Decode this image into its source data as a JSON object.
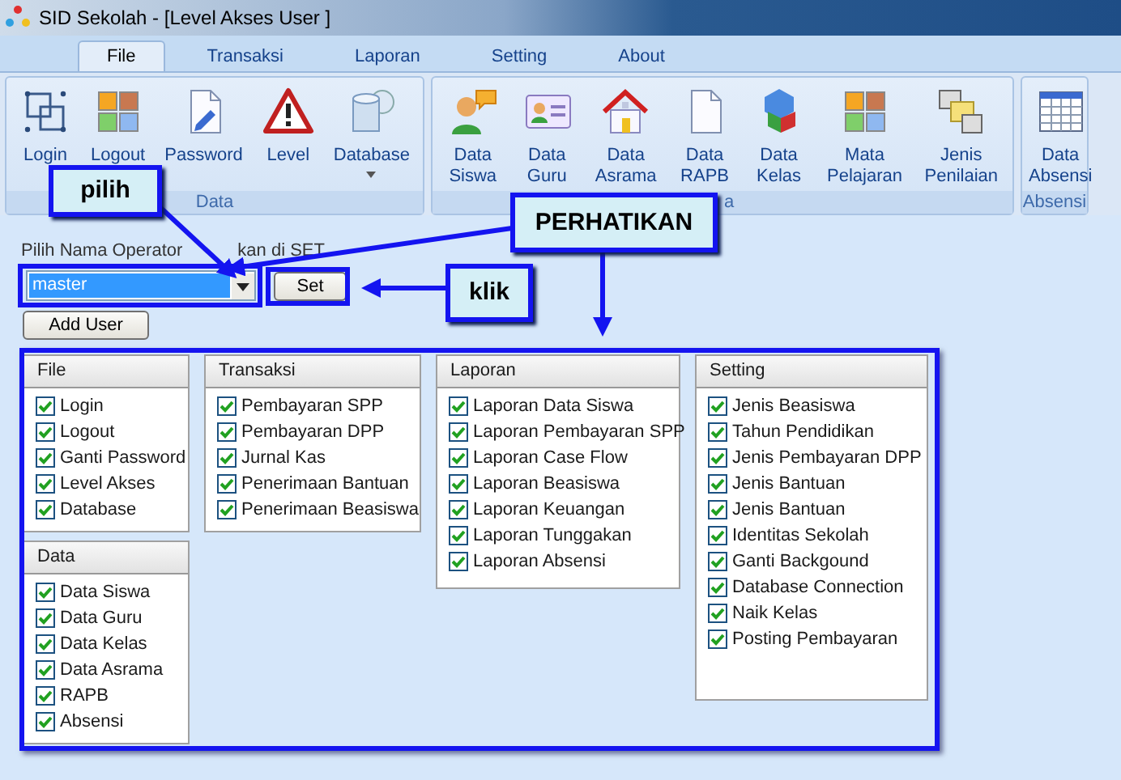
{
  "window": {
    "title": "SID Sekolah - [Level Akses User ]"
  },
  "tabs": [
    {
      "label": "File",
      "selected": true
    },
    {
      "label": "Transaksi",
      "selected": false
    },
    {
      "label": "Laporan",
      "selected": false
    },
    {
      "label": "Setting",
      "selected": false
    },
    {
      "label": "About",
      "selected": false
    }
  ],
  "ribbon": {
    "groups": [
      {
        "label": "Data",
        "buttons": [
          {
            "lines": [
              "Login"
            ]
          },
          {
            "lines": [
              "Logout"
            ]
          },
          {
            "lines": [
              "Password"
            ]
          },
          {
            "lines": [
              "Level"
            ]
          },
          {
            "lines": [
              "Database"
            ],
            "dropdown": true
          }
        ]
      },
      {
        "label": "a",
        "buttons": [
          {
            "lines": [
              "Data",
              "Siswa"
            ]
          },
          {
            "lines": [
              "Data",
              "Guru"
            ]
          },
          {
            "lines": [
              "Data",
              "Asrama"
            ]
          },
          {
            "lines": [
              "Data",
              "RAPB"
            ]
          },
          {
            "lines": [
              "Data",
              "Kelas"
            ]
          },
          {
            "lines": [
              "Mata",
              "Pelajaran"
            ]
          },
          {
            "lines": [
              "Jenis",
              "Penilaian"
            ]
          }
        ]
      },
      {
        "label": "Absensi",
        "buttons": [
          {
            "lines": [
              "Data",
              "Absensi"
            ]
          }
        ]
      }
    ]
  },
  "form": {
    "prompt": [
      "Pilih Nama Operator",
      "kan di SET"
    ],
    "operator": {
      "value": "master"
    },
    "set_button": "Set",
    "add_user_button": "Add User"
  },
  "columns": [
    {
      "panels": [
        {
          "title": "File",
          "items": [
            {
              "label": "Login",
              "checked": true
            },
            {
              "label": "Logout",
              "checked": true
            },
            {
              "label": "Ganti Password",
              "checked": true
            },
            {
              "label": "Level Akses",
              "checked": true
            },
            {
              "label": "Database",
              "checked": true
            }
          ]
        },
        {
          "title": "Data",
          "items": [
            {
              "label": "Data Siswa",
              "checked": true
            },
            {
              "label": "Data Guru",
              "checked": true
            },
            {
              "label": "Data Kelas",
              "checked": true
            },
            {
              "label": "Data Asrama",
              "checked": true
            },
            {
              "label": "RAPB",
              "checked": true
            },
            {
              "label": "Absensi",
              "checked": true
            }
          ]
        }
      ]
    },
    {
      "panels": [
        {
          "title": "Transaksi",
          "items": [
            {
              "label": "Pembayaran SPP",
              "checked": true
            },
            {
              "label": "Pembayaran DPP",
              "checked": true
            },
            {
              "label": "Jurnal Kas",
              "checked": true
            },
            {
              "label": "Penerimaan Bantuan",
              "checked": true
            },
            {
              "label": "Penerimaan Beasiswa",
              "checked": true
            }
          ]
        }
      ]
    },
    {
      "panels": [
        {
          "title": "Laporan",
          "items": [
            {
              "label": "Laporan Data Siswa",
              "checked": true
            },
            {
              "label": "Laporan Pembayaran SPP",
              "checked": true
            },
            {
              "label": "Laporan Case Flow",
              "checked": true
            },
            {
              "label": "Laporan Beasiswa",
              "checked": true
            },
            {
              "label": "Laporan Keuangan",
              "checked": true
            },
            {
              "label": "Laporan Tunggakan",
              "checked": true
            },
            {
              "label": "Laporan Absensi",
              "checked": true
            }
          ]
        }
      ]
    },
    {
      "panels": [
        {
          "title": "Setting",
          "items": [
            {
              "label": "Jenis Beasiswa",
              "checked": true
            },
            {
              "label": "Tahun Pendidikan",
              "checked": true
            },
            {
              "label": "Jenis Pembayaran DPP",
              "checked": true
            },
            {
              "label": "Jenis Bantuan",
              "checked": true
            },
            {
              "label": "Jenis Bantuan",
              "checked": true
            },
            {
              "label": "Identitas Sekolah",
              "checked": true
            },
            {
              "label": "Ganti Backgound",
              "checked": true
            },
            {
              "label": "Database Connection",
              "checked": true
            },
            {
              "label": "Naik Kelas",
              "checked": true
            },
            {
              "label": "Posting Pembayaran",
              "checked": true
            }
          ]
        }
      ]
    }
  ],
  "callouts": [
    {
      "text": "pilih"
    },
    {
      "text": "PERHATIKAN"
    },
    {
      "text": "klik"
    }
  ]
}
